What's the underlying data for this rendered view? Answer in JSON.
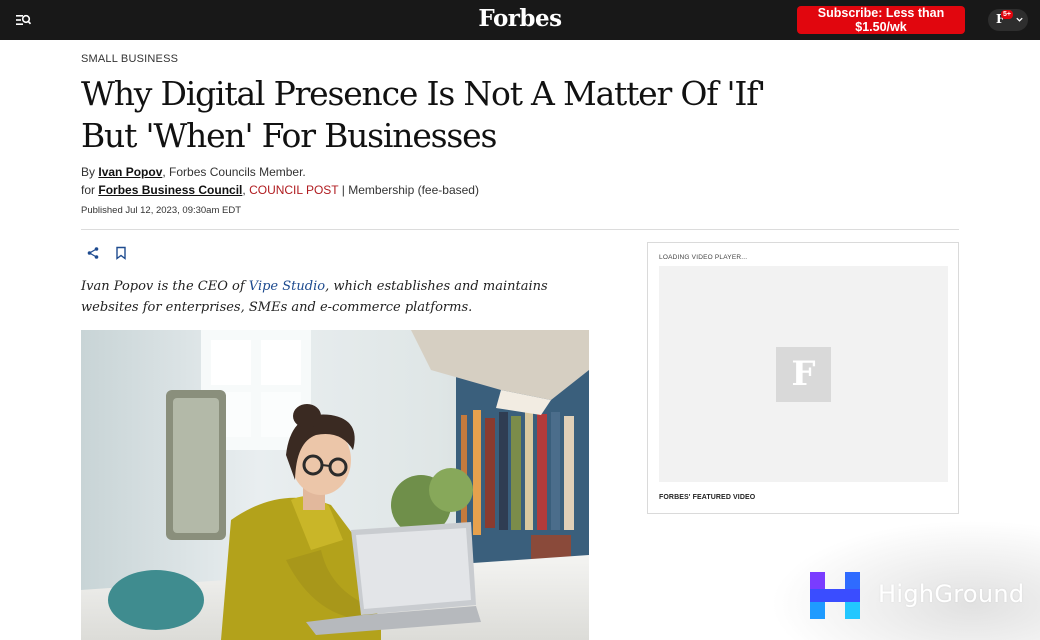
{
  "header": {
    "logo": "Forbes",
    "subscribe_label": "Subscribe: Less than $1.50/wk",
    "account_initial": "F",
    "notification_count": "5+",
    "icons": [
      "menu-search-icon",
      "chevron-down-icon"
    ]
  },
  "article": {
    "kicker": "SMALL BUSINESS",
    "headline": "Why Digital Presence Is Not A Matter Of 'If' But 'When' For Businesses",
    "byline": {
      "by": "By",
      "author": "Ivan Popov",
      "author_role": "Forbes Councils Member.",
      "for": "for",
      "council": "Forbes Business Council",
      "council_post": "COUNCIL POST",
      "separator": "|",
      "membership": "Membership (fee-based)"
    },
    "published": "Published Jul 12, 2023, 09:30am EDT",
    "actions": [
      "share-icon",
      "bookmark-icon"
    ],
    "lede": {
      "prefix": "Ivan Popov is the CEO of ",
      "link": "Vipe Studio",
      "suffix": ", which establishes and maintains websites for enterprises, SMEs and e-commerce platforms."
    }
  },
  "video": {
    "loading_text": "LOADING VIDEO PLAYER...",
    "placeholder_letter": "F",
    "caption": "FORBES' FEATURED VIDEO"
  },
  "watermark": {
    "brand": "HighGround"
  },
  "colors": {
    "topbar": "#181818",
    "subscribe": "#e1060e",
    "council_post": "#b01c20",
    "link": "#1e4b8f"
  }
}
